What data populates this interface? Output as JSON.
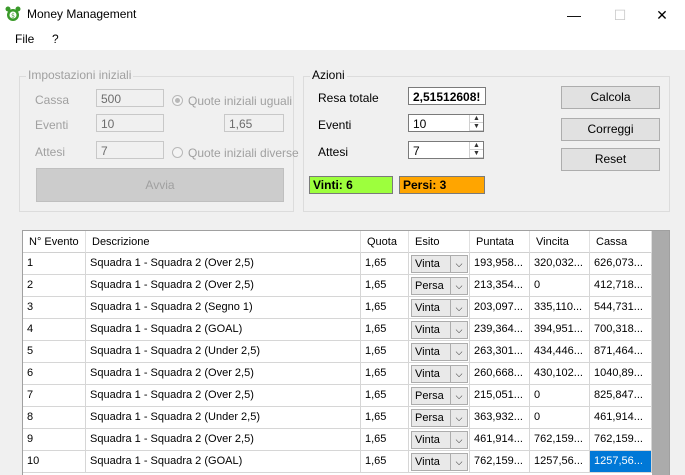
{
  "window": {
    "title": "Money Management",
    "minimize": "—",
    "maximize": "☐",
    "close": "✕"
  },
  "menu": {
    "file": "File",
    "help": "?"
  },
  "initial_settings": {
    "legend": "Impostazioni iniziali",
    "cassa_label": "Cassa",
    "cassa_value": "500",
    "eventi_label": "Eventi",
    "eventi_value": "10",
    "attesi_label": "Attesi",
    "attesi_value": "7",
    "quote_uguali": "Quote iniziali uguali",
    "quote_value": "1,65",
    "quote_diverse": "Quote iniziali diverse",
    "avvia": "Avvia"
  },
  "actions": {
    "legend": "Azioni",
    "resa_label": "Resa totale",
    "resa_value": "2,51512608!",
    "eventi_label": "Eventi",
    "eventi_value": "10",
    "attesi_label": "Attesi",
    "attesi_value": "7",
    "vinti": "Vinti: 6",
    "persi": "Persi: 3",
    "calcola": "Calcola",
    "correggi": "Correggi",
    "reset": "Reset",
    "vinti_color": "#9dff3d",
    "persi_color": "#ffa500"
  },
  "grid": {
    "headers": [
      "N° Evento",
      "Descrizione",
      "Quota",
      "Esito",
      "Puntata",
      "Vincita",
      "Cassa"
    ],
    "rows": [
      {
        "n": "1",
        "desc": "Squadra 1 - Squadra 2 (Over 2,5)",
        "quota": "1,65",
        "esito": "Vinta",
        "puntata": "193,958...",
        "vincita": "320,032...",
        "cassa": "626,073..."
      },
      {
        "n": "2",
        "desc": "Squadra 1 - Squadra 2 (Over 2,5)",
        "quota": "1,65",
        "esito": "Persa",
        "puntata": "213,354...",
        "vincita": "0",
        "cassa": "412,718..."
      },
      {
        "n": "3",
        "desc": "Squadra 1 - Squadra 2 (Segno 1)",
        "quota": "1,65",
        "esito": "Vinta",
        "puntata": "203,097...",
        "vincita": "335,110...",
        "cassa": "544,731..."
      },
      {
        "n": "4",
        "desc": "Squadra 1 - Squadra 2 (GOAL)",
        "quota": "1,65",
        "esito": "Vinta",
        "puntata": "239,364...",
        "vincita": "394,951...",
        "cassa": "700,318..."
      },
      {
        "n": "5",
        "desc": "Squadra 1 - Squadra 2 (Under 2,5)",
        "quota": "1,65",
        "esito": "Vinta",
        "puntata": "263,301...",
        "vincita": "434,446...",
        "cassa": "871,464..."
      },
      {
        "n": "6",
        "desc": "Squadra 1 - Squadra 2 (Over 2,5)",
        "quota": "1,65",
        "esito": "Vinta",
        "puntata": "260,668...",
        "vincita": "430,102...",
        "cassa": "1040,89..."
      },
      {
        "n": "7",
        "desc": "Squadra 1 - Squadra 2 (Over 2,5)",
        "quota": "1,65",
        "esito": "Persa",
        "puntata": "215,051...",
        "vincita": "0",
        "cassa": "825,847..."
      },
      {
        "n": "8",
        "desc": "Squadra 1 - Squadra 2 (Under 2,5)",
        "quota": "1,65",
        "esito": "Persa",
        "puntata": "363,932...",
        "vincita": "0",
        "cassa": "461,914..."
      },
      {
        "n": "9",
        "desc": "Squadra 1 - Squadra 2 (Over 2,5)",
        "quota": "1,65",
        "esito": "Vinta",
        "puntata": "461,914...",
        "vincita": "762,159...",
        "cassa": "762,159..."
      },
      {
        "n": "10",
        "desc": "Squadra 1 - Squadra 2 (GOAL)",
        "quota": "1,65",
        "esito": "Vinta",
        "puntata": "762,159...",
        "vincita": "1257,56...",
        "cassa": "1257,56..."
      }
    ]
  }
}
